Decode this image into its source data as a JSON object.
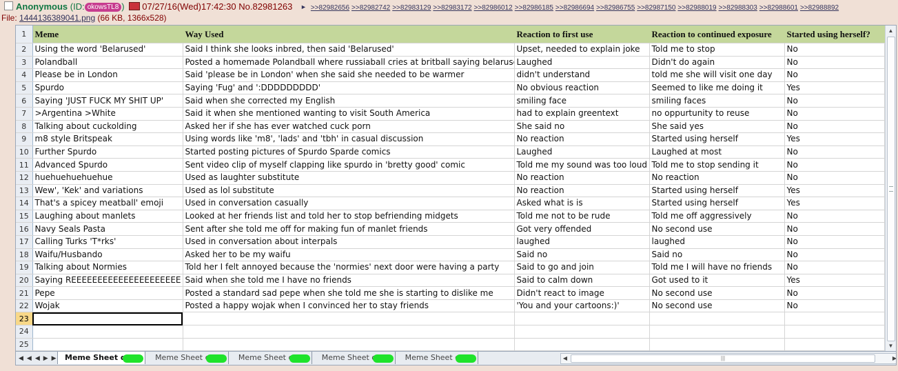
{
  "post": {
    "name": "Anonymous",
    "id_label": "(ID:",
    "id_value": "okowsTL8",
    "id_close": ")",
    "datetime": "07/27/16(Wed)17:42:30",
    "number": "No.82981263",
    "replies": [
      ">>82982656",
      ">>82982742",
      ">>82983129",
      ">>82983172",
      ">>82986012",
      ">>82986185",
      ">>82986694",
      ">>82986755",
      ">>82987150",
      ">>82988019",
      ">>82988303",
      ">>82988601",
      ">>82988892"
    ],
    "file_prefix": "File:",
    "file_name": "1444136389041.png",
    "file_info": "(66 KB, 1366x528)"
  },
  "sheet": {
    "headers": [
      "Meme",
      "Way Used",
      "Reaction to first use",
      "Reaction to continued exposure",
      "Started using herself?"
    ],
    "rows": [
      [
        "Using the word 'Belarused'",
        "Said I think she looks inbred, then said 'Belarused'",
        "Upset, needed to explain joke",
        "Told me to stop",
        "No"
      ],
      [
        "Polandball",
        "Posted a homemade Polandball where russiaball cries at britball saying belarused",
        "Laughed",
        "Didn't do again",
        "No"
      ],
      [
        "Please be in London",
        "Said 'please be in London' when she said she needed to be warmer",
        "didn't understand",
        "told me she will visit one day",
        "No"
      ],
      [
        "Spurdo",
        "Saying 'Fug' and ':DDDDDDDDD'",
        "No obvious reaction",
        "Seemed to like me doing it",
        "Yes"
      ],
      [
        "Saying 'JUST FUCK MY SHIT UP'",
        "Said when she corrected my English",
        "smiling face",
        "smiling faces",
        "No"
      ],
      [
        ">Argentina >White",
        "Said it when she mentioned wanting to visit South America",
        "had to explain greentext",
        "no oppurtunity to reuse",
        "No"
      ],
      [
        "Talking about cuckolding",
        "Asked her if she has ever watched cuck porn",
        "She said no",
        "She said yes",
        "No"
      ],
      [
        "m8 style Britspeak",
        "Using words like 'm8', 'lads' and 'tbh' in casual discussion",
        "No reaction",
        "Started using herself",
        "Yes"
      ],
      [
        "Further Spurdo",
        "Started posting pictures of Spurdo Sparde comics",
        "Laughed",
        "Laughed at most",
        "No"
      ],
      [
        "Advanced Spurdo",
        "Sent video clip of myself clapping like spurdo in 'bretty good' comic",
        "Told me my sound was too loud",
        "Told me to stop sending it",
        "No"
      ],
      [
        "huehuehuehuehue",
        "Used as laughter substitute",
        "No reaction",
        "No reaction",
        "No"
      ],
      [
        "Wew', 'Kek' and variations",
        "Used as lol substitute",
        "No reaction",
        "Started using herself",
        "Yes"
      ],
      [
        "That's a spicey meatball' emoji",
        "Used in conversation casually",
        "Asked what is is",
        "Started using herself",
        "Yes"
      ],
      [
        "Laughing about manlets",
        "Looked at her friends list and told her to stop befriending midgets",
        "Told me not to be rude",
        "Told me off aggressively",
        "No"
      ],
      [
        "Navy Seals Pasta",
        "Sent after she told me off for making fun of manlet friends",
        "Got very offended",
        "No second use",
        "No"
      ],
      [
        "Calling Turks 'T*rks'",
        "Used in conversation about interpals",
        "laughed",
        "laughed",
        "No"
      ],
      [
        "Waifu/Husbando",
        "Asked her to be my waifu",
        "Said no",
        "Said no",
        "No"
      ],
      [
        "Talking about Normies",
        "Told her I felt annoyed because the 'normies' next door were having a party",
        "Said to go and join",
        "Told me I will have no friends",
        "No"
      ],
      [
        "Saying REEEEEEEEEEEEEEEEEEEEE",
        "Said when she told me I have no friends",
        "Said to calm down",
        "Got used to it",
        "Yes"
      ],
      [
        "Pepe",
        "Posted a standard sad pepe when she told me she is starting to dislike me",
        "Didn't react to image",
        "No second use",
        "No"
      ],
      [
        "Wojak",
        "Posted a happy wojak when I convinced her to stay friends",
        "'You and your cartoons:)'",
        "No second use",
        "No"
      ]
    ],
    "empty_rows": [
      23,
      24,
      25
    ],
    "selected_row": 23
  },
  "tabs": [
    "Meme Sheet qt",
    "Meme Sheet qt",
    "Meme Sheet qt",
    "Meme Sheet qt",
    "Meme Sheet qt"
  ],
  "active_tab": 0,
  "colors": {
    "background": "#f0e0d6",
    "header_fill": "#c4d79b",
    "name_green": "#117743",
    "id_badge": "#c73c8f",
    "link": "#34345c",
    "tab_scribble": "#1fe32b"
  }
}
